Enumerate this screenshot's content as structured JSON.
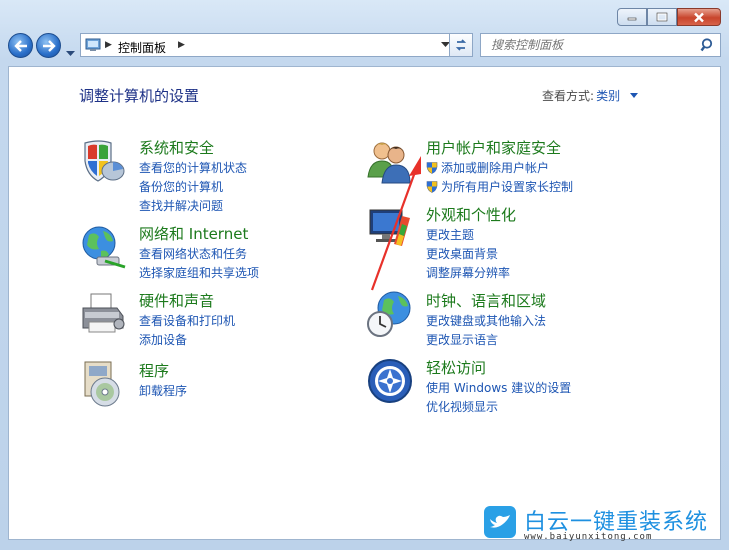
{
  "window": {
    "caption_buttons": [
      "minimize-icon",
      "maximize-icon",
      "close-icon"
    ]
  },
  "address_bar": {
    "breadcrumb": "控制面板"
  },
  "search": {
    "placeholder": "搜索控制面板"
  },
  "main": {
    "heading": "调整计算机的设置",
    "view_by_label": "查看方式:",
    "view_by_value": "类别"
  },
  "categories": [
    {
      "title": "系统和安全",
      "icon": "shield-flag-icon",
      "links": [
        "查看您的计算机状态",
        "备份您的计算机",
        "查找并解决问题"
      ]
    },
    {
      "title": "网络和 Internet",
      "icon": "globe-network-icon",
      "links": [
        "查看网络状态和任务",
        "选择家庭组和共享选项"
      ]
    },
    {
      "title": "硬件和声音",
      "icon": "printer-icon",
      "links": [
        "查看设备和打印机",
        "添加设备"
      ]
    },
    {
      "title": "程序",
      "icon": "programs-disc-icon",
      "links": [
        "卸载程序"
      ]
    },
    {
      "title": "用户帐户和家庭安全",
      "icon": "users-icon",
      "links": [
        "添加或删除用户帐户",
        "为所有用户设置家长控制"
      ],
      "link_icons": [
        "uac-shield-icon",
        "uac-shield-icon"
      ]
    },
    {
      "title": "外观和个性化",
      "icon": "monitor-paint-icon",
      "links": [
        "更改主题",
        "更改桌面背景",
        "调整屏幕分辨率"
      ]
    },
    {
      "title": "时钟、语言和区域",
      "icon": "globe-clock-icon",
      "links": [
        "更改键盘或其他输入法",
        "更改显示语言"
      ]
    },
    {
      "title": "轻松访问",
      "icon": "ease-of-access-icon",
      "links": [
        "使用 Windows 建议的设置",
        "优化视频显示"
      ]
    }
  ],
  "watermark": {
    "brand": "白云一键重装系统",
    "url": "www.baiyunxitong.com"
  },
  "colors": {
    "title_green": "#1c7a1c",
    "link_blue": "#1e56b3",
    "heading_blue": "#1e3287",
    "annotation_red": "#e8312a"
  }
}
